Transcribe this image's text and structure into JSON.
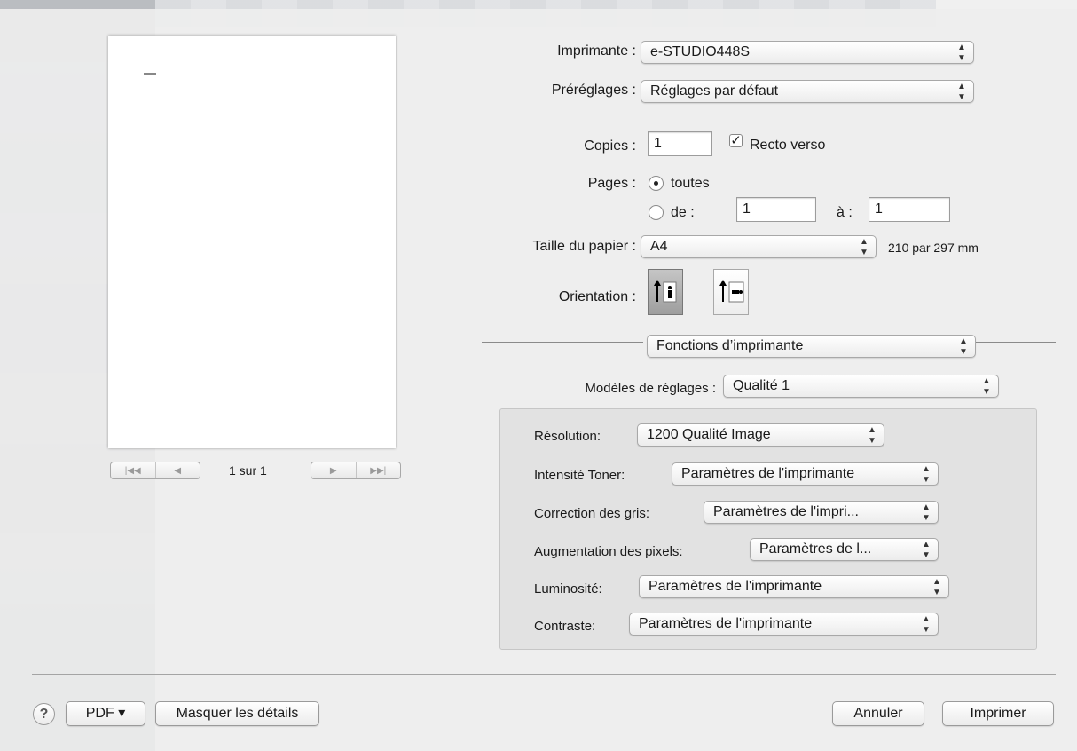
{
  "printer": {
    "label": "Imprimante :",
    "value": "e-STUDIO448S"
  },
  "presets": {
    "label": "Préréglages :",
    "value": "Réglages par défaut"
  },
  "copies": {
    "label": "Copies :",
    "value": "1",
    "duplex_label": "Recto verso",
    "duplex_checked": true
  },
  "pages": {
    "label": "Pages :",
    "all_label": "toutes",
    "range_label": "de :",
    "from": "1",
    "to_label": "à :",
    "to": "1"
  },
  "paper": {
    "label": "Taille du papier :",
    "value": "A4",
    "dimensions": "210 par 297 mm"
  },
  "orientation": {
    "label": "Orientation :",
    "selected": "portrait"
  },
  "section": {
    "value": "Fonctions d’imprimante"
  },
  "models": {
    "label": "Modèles de réglages :",
    "value": "Qualité 1"
  },
  "settings": [
    {
      "label": "Résolution:",
      "value": "1200 Qualité Image"
    },
    {
      "label": "Intensité Toner:",
      "value": "Paramètres de l'imprimante"
    },
    {
      "label": "Correction des gris:",
      "value": "Paramètres de l'impri..."
    },
    {
      "label": "Augmentation des pixels:",
      "value": "Paramètres de l..."
    },
    {
      "label": "Luminosité:",
      "value": "Paramètres de l'imprimante"
    },
    {
      "label": "Contraste:",
      "value": "Paramètres de l'imprimante"
    }
  ],
  "preview": {
    "page_label": "1 sur 1"
  },
  "footer": {
    "help": "?",
    "pdf": "PDF ▾",
    "hide_details": "Masquer les détails",
    "cancel": "Annuler",
    "print": "Imprimer"
  }
}
